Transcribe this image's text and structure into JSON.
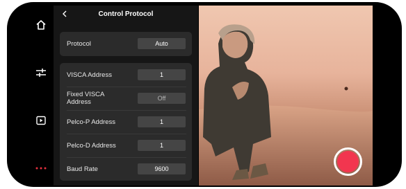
{
  "header": {
    "title": "Control Protocol"
  },
  "rail": {
    "icons": [
      "home-icon",
      "settings-sliders-icon",
      "playback-icon",
      "more-icon"
    ],
    "accent": "#e3303e"
  },
  "protocol": {
    "label": "Protocol",
    "value": "Auto"
  },
  "settings": [
    {
      "label": "VISCA Address",
      "value": "1"
    },
    {
      "label": "Fixed VISCA Address",
      "value": "Off"
    },
    {
      "label": "Pelco-P Address",
      "value": "1"
    },
    {
      "label": "Pelco-D Address",
      "value": "1"
    },
    {
      "label": "Baud Rate",
      "value": "9600"
    }
  ],
  "colors": {
    "panel_bg": "#161616",
    "card_bg": "#2b2b2b",
    "value_bg": "#454545",
    "record": "#f2364f"
  }
}
